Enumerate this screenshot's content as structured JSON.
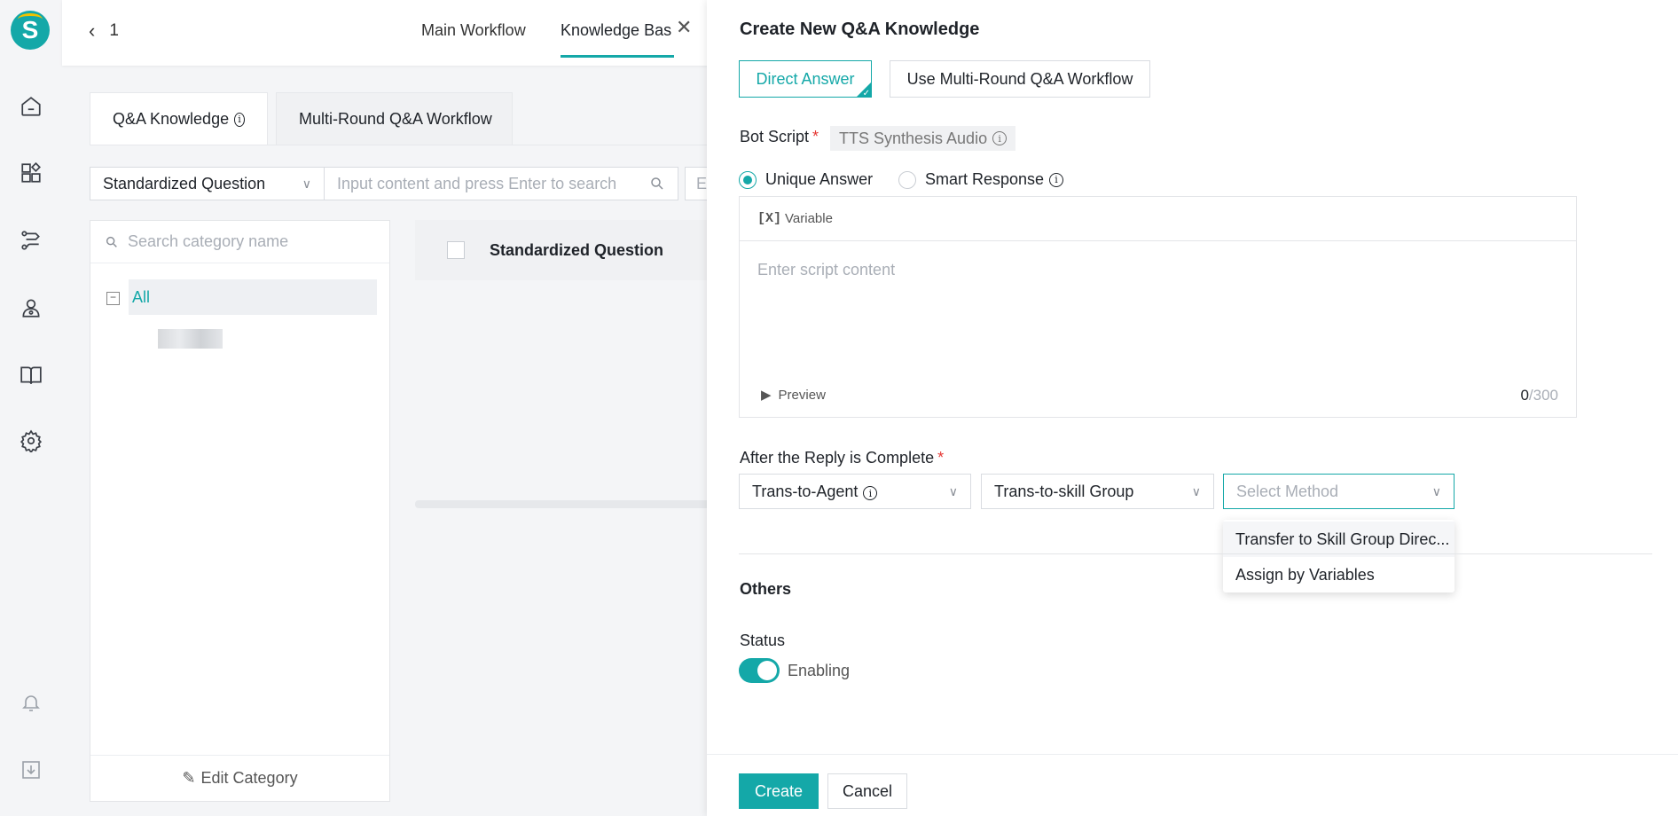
{
  "rail": {
    "logo_letter": "S",
    "icons": [
      "home-icon",
      "apps-icon",
      "workflow-icon",
      "agent-icon",
      "book-icon",
      "gear-icon",
      "bell-icon",
      "download-icon"
    ]
  },
  "header": {
    "back_number": "1",
    "tabs": [
      "Main Workflow",
      "Knowledge Bas"
    ]
  },
  "kb": {
    "tabs": [
      "Q&A Knowledge",
      "Multi-Round Q&A Workflow"
    ],
    "filter_select": "Standardized Question",
    "search_placeholder": "Input content and press Enter to search",
    "extra_input_partial": "E",
    "category_search_placeholder": "Search category name",
    "tree_all": "All",
    "edit_category": "Edit Category",
    "table_header": "Standardized Question"
  },
  "drawer": {
    "title": "Create New Q&A Knowledge",
    "modes": [
      "Direct Answer",
      "Use Multi-Round Q&A Workflow"
    ],
    "bot_script_label": "Bot Script",
    "tts_label": "TTS Synthesis Audio",
    "radios": [
      "Unique Answer",
      "Smart Response"
    ],
    "variable_label": "Variable",
    "variable_icon": "[X]",
    "script_placeholder": "Enter script content",
    "preview_label": "Preview",
    "counter_current": "0",
    "counter_max": "/300",
    "after_reply_label": "After the Reply is Complete",
    "dropdowns": [
      "Trans-to-Agent",
      "Trans-to-skill Group"
    ],
    "method_placeholder": "Select Method",
    "method_options": [
      "Transfer to Skill Group Direc...",
      "Assign by Variables"
    ],
    "others_title": "Others",
    "status_label": "Status",
    "status_value": "Enabling",
    "create_label": "Create",
    "cancel_label": "Cancel"
  },
  "colors": {
    "accent": "#14a8a8",
    "required": "#e53935",
    "logo_arc": "#f2c200"
  }
}
